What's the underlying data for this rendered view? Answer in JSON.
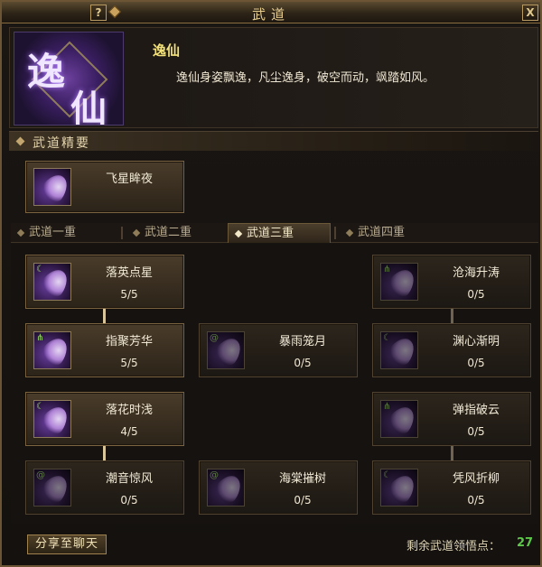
{
  "window": {
    "title": "武道",
    "help_label": "?",
    "close_label": "X"
  },
  "header": {
    "emblem_chars": [
      "逸",
      "仙"
    ],
    "school_name": "逸仙",
    "description": "逸仙身姿飘逸，凡尘逸身，破空而动，飒踏如风。"
  },
  "essentials": {
    "section_title": "武道精要",
    "skill": {
      "name": "飞星眸夜"
    }
  },
  "tabs": [
    {
      "label": "武道一重",
      "active": false
    },
    {
      "label": "武道二重",
      "active": false
    },
    {
      "label": "武道三重",
      "active": true
    },
    {
      "label": "武道四重",
      "active": false
    }
  ],
  "skills": [
    {
      "name": "落英点星",
      "level": "5/5",
      "learned": true
    },
    {
      "name": "沧海升涛",
      "level": "0/5",
      "learned": false
    },
    {
      "name": "指聚芳华",
      "level": "5/5",
      "learned": true
    },
    {
      "name": "暴雨笼月",
      "level": "0/5",
      "learned": false
    },
    {
      "name": "渊心渐明",
      "level": "0/5",
      "learned": false
    },
    {
      "name": "落花时浅",
      "level": "4/5",
      "learned": true
    },
    {
      "name": "弹指破云",
      "level": "0/5",
      "learned": false
    },
    {
      "name": "潮音惊风",
      "level": "0/5",
      "learned": false
    },
    {
      "name": "海棠摧树",
      "level": "0/5",
      "learned": false
    },
    {
      "name": "凭风折柳",
      "level": "0/5",
      "learned": false
    }
  ],
  "footer": {
    "share_label": "分享至聊天",
    "points_label": "剩余武道领悟点：",
    "points_value": "27"
  },
  "colors": {
    "accent_gold": "#f3e27a",
    "points_green": "#5ec84a",
    "tab_active": "#f3e8c8"
  }
}
